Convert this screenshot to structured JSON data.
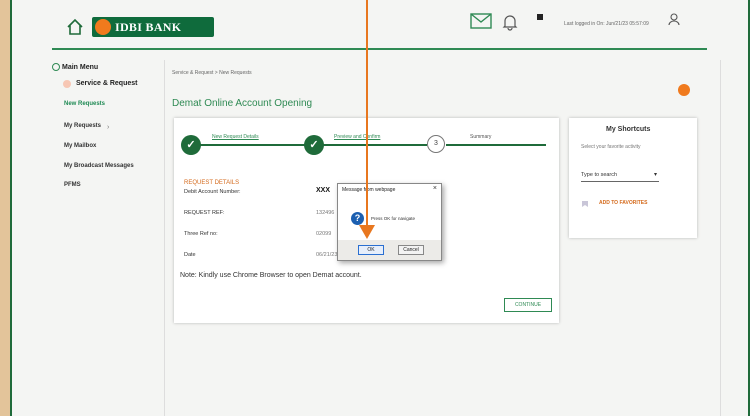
{
  "header": {
    "logo_text": "IDBI BANK",
    "last_login": "Last logged in On: Jun/21/23 05:57:09"
  },
  "sidebar": {
    "main_menu": "Main Menu",
    "service_request": "Service & Request",
    "items": [
      {
        "label": "New Requests"
      },
      {
        "label": "My Requests"
      },
      {
        "label": "My Mailbox"
      },
      {
        "label": "My Broadcast Messages"
      },
      {
        "label": "PFMS"
      }
    ]
  },
  "main": {
    "breadcrumb": "Service & Request > New Requests",
    "title": "Demat Online Account Opening",
    "steps": [
      {
        "label": "New Request Details"
      },
      {
        "label": "Preview and Confirm"
      },
      {
        "number": "3",
        "label": "Summary"
      }
    ],
    "request_details_title": "REQUEST DETAILS",
    "rows": [
      {
        "label": "Debit Account Number:",
        "value": "XXX"
      },
      {
        "label": "REQUEST REF:",
        "value": "132496"
      },
      {
        "label": "Three Ref no:",
        "value": "02099"
      },
      {
        "label": "Date",
        "value": "06/21/23"
      }
    ],
    "note": "Note: Kindly use Chrome Browser to open Demat account.",
    "continue_label": "CONTINUE"
  },
  "dialog": {
    "title": "Message from webpage",
    "message": "Press OK for navigate",
    "ok_label": "OK",
    "cancel_label": "Cancel"
  },
  "shortcuts": {
    "title": "My Shortcuts",
    "subtitle": "Select your favorite activity",
    "select_value": "Type to search",
    "add_label": "ADD TO FAVORITES"
  },
  "colors": {
    "brand_green": "#1f6b3a",
    "accent_orange": "#e8771f",
    "link_green": "#2f8a54"
  }
}
